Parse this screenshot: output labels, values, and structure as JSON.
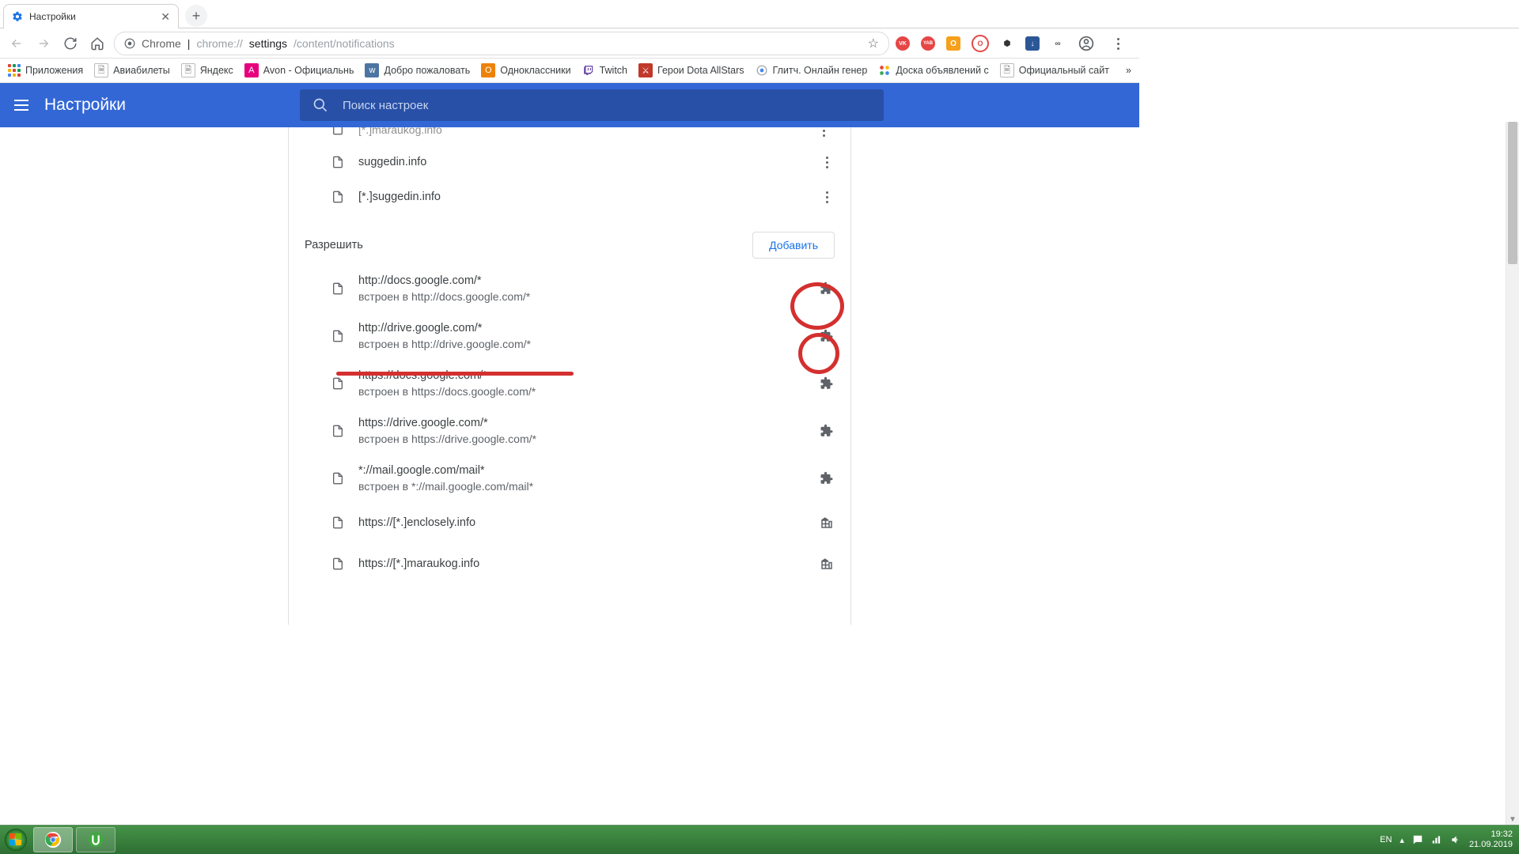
{
  "window": {
    "minimize": "–",
    "maximize": "❐",
    "close": "✕"
  },
  "tab": {
    "title": "Настройки",
    "close": "✕",
    "new_tab": "+"
  },
  "nav": {
    "back": "←",
    "forward": "→",
    "reload": "↻",
    "home": "⌂"
  },
  "omnibox": {
    "scheme_label": "Chrome",
    "separator": "|",
    "url_prefix": "chrome://",
    "url_bold": "settings",
    "url_suffix": "/content/notifications",
    "star": "☆"
  },
  "extensions": {
    "vk": "VK",
    "yab": "YAB",
    "ok": "O",
    "opera": "O",
    "devtools": "⬢",
    "save": "↓",
    "infinity": "∞",
    "profile": "👤",
    "menu": "⋮"
  },
  "bookmarks": {
    "apps": "Приложения",
    "items": [
      "Авиабилеты",
      "Яндекс",
      "Avon - Официальнь",
      "Добро пожаловать",
      "Одноклассники",
      "Twitch",
      "Герои Dota AllStars",
      "Глитч. Онлайн генер",
      "Доска объявлений с",
      "Официальный сайт"
    ],
    "more": "»"
  },
  "settings": {
    "title": "Настройки",
    "search_placeholder": "Поиск настроек"
  },
  "block_section": {
    "cut_item": "[*.]maraukog.info",
    "rows": [
      {
        "title": "suggedin.info"
      },
      {
        "title": "[*.]suggedin.info"
      }
    ]
  },
  "allow_section": {
    "label": "Разрешить",
    "add_btn": "Добавить",
    "rows": [
      {
        "title": "http://docs.google.com/*",
        "sub": "встроен в http://docs.google.com/*",
        "icon": "ext"
      },
      {
        "title": "http://drive.google.com/*",
        "sub": "встроен в http://drive.google.com/*",
        "icon": "ext"
      },
      {
        "title": "https://docs.google.com/*",
        "sub": "встроен в https://docs.google.com/*",
        "icon": "ext"
      },
      {
        "title": "https://drive.google.com/*",
        "sub": "встроен в https://drive.google.com/*",
        "icon": "ext"
      },
      {
        "title": "*://mail.google.com/mail*",
        "sub": "встроен в *://mail.google.com/mail*",
        "icon": "ext"
      },
      {
        "title": "https://[*.]enclosely.info",
        "sub": "",
        "icon": "org"
      },
      {
        "title": "https://[*.]maraukog.info",
        "sub": "",
        "icon": "org"
      }
    ]
  },
  "taskbar": {
    "lang": "EN",
    "time": "19:32",
    "date": "21.09.2019"
  }
}
